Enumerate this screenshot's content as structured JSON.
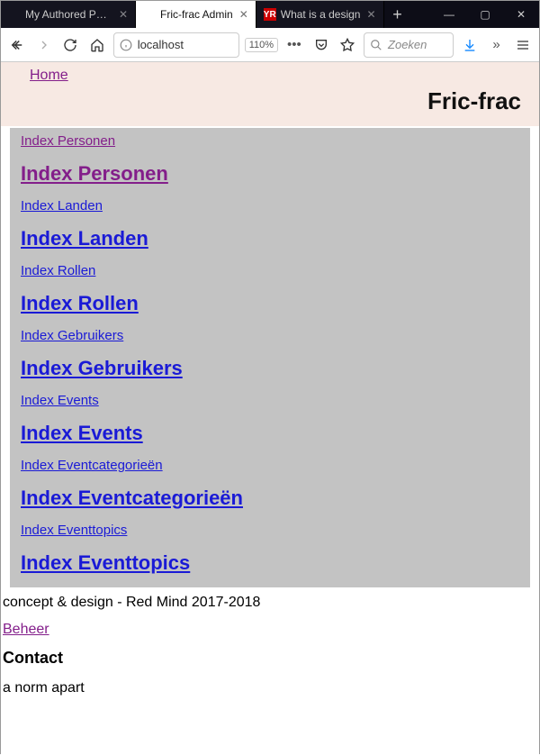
{
  "browser": {
    "tabs": [
      {
        "label": "My Authored Page w",
        "active": false,
        "favicon": ""
      },
      {
        "label": "Fric-frac Admin",
        "active": true,
        "favicon": ""
      },
      {
        "label": "What is a design",
        "active": false,
        "favicon": "YR"
      }
    ],
    "url_prefix": "localhost",
    "zoom": "110%",
    "search_placeholder": "Zoeken"
  },
  "page": {
    "home": "Home",
    "brand": "Fric-frac",
    "sections": [
      {
        "small": "Index Personen",
        "big": "Index Personen",
        "visited": true
      },
      {
        "small": "Index Landen",
        "big": "Index Landen",
        "visited": false
      },
      {
        "small": "Index Rollen",
        "big": "Index Rollen",
        "visited": false
      },
      {
        "small": "Index Gebruikers",
        "big": "Index Gebruikers",
        "visited": false
      },
      {
        "small": "Index Events",
        "big": "Index Events",
        "visited": false
      },
      {
        "small": "Index Eventcategorieën",
        "big": "Index Eventcategorieën",
        "visited": false
      },
      {
        "small": "Index Eventtopics",
        "big": "Index Eventtopics",
        "visited": false
      }
    ],
    "footer_concept": "concept & design - Red Mind 2017-2018",
    "beheer": "Beheer",
    "contact": "Contact",
    "norm": "a norm apart"
  }
}
